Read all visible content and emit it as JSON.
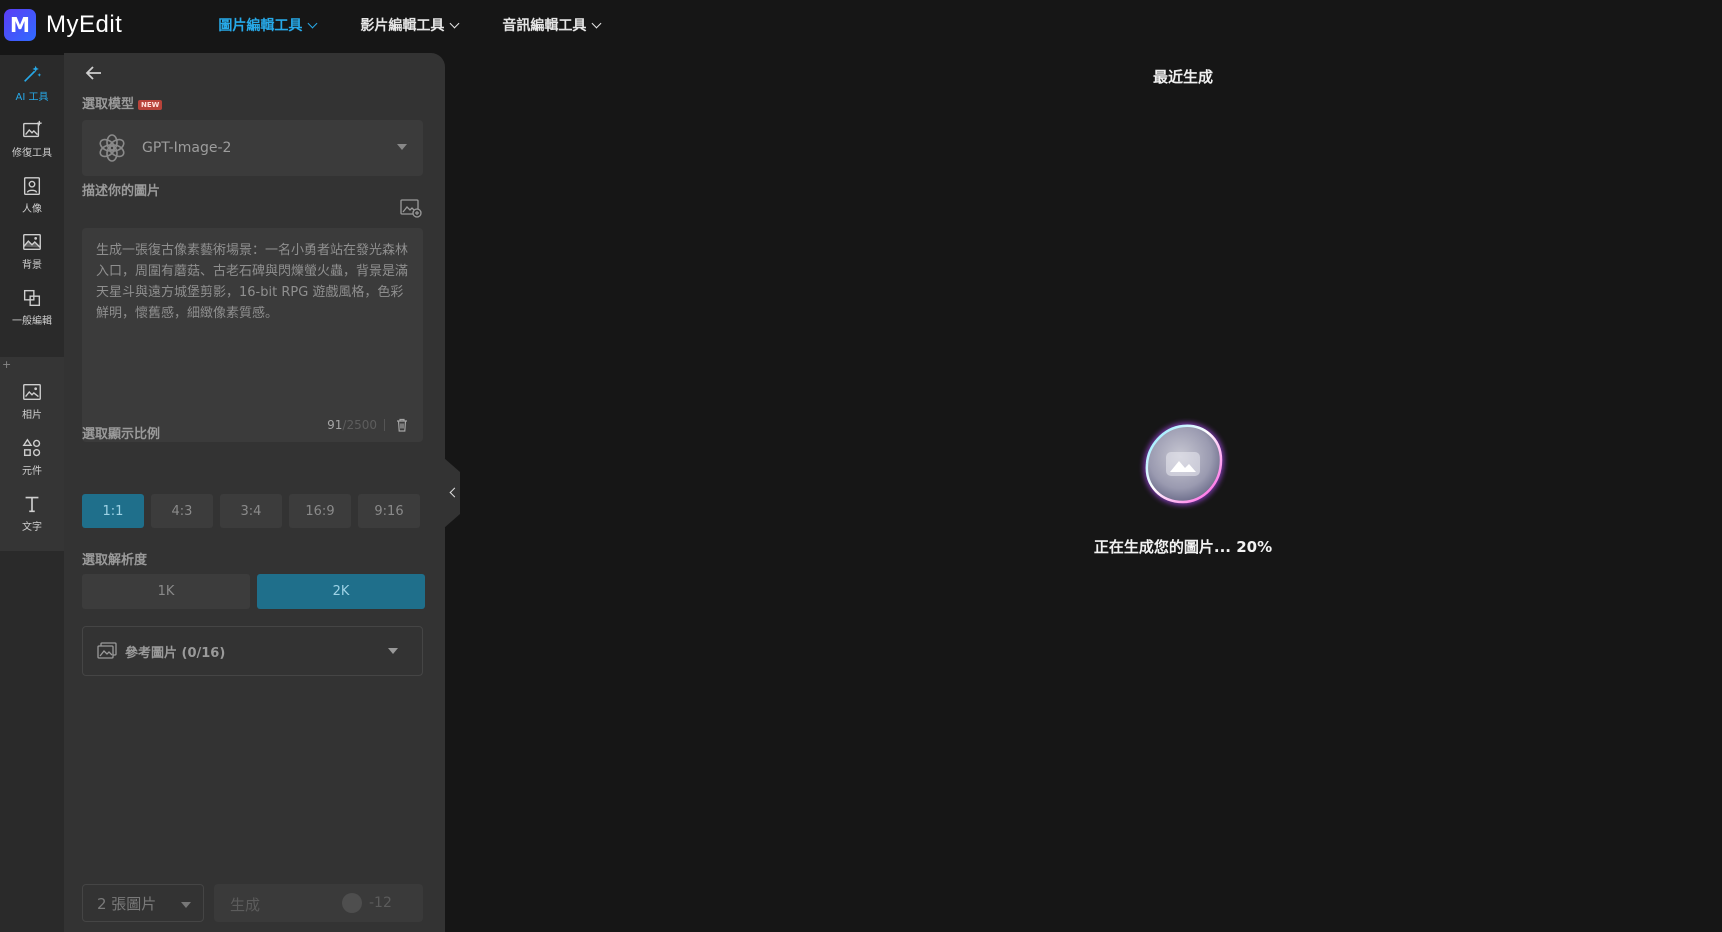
{
  "app": {
    "name": "MyEdit",
    "logo_letter": "M"
  },
  "nav": {
    "items": [
      {
        "label": "圖片編輯工具",
        "active": true
      },
      {
        "label": "影片編輯工具",
        "active": false
      },
      {
        "label": "音訊編輯工具",
        "active": false
      }
    ]
  },
  "rail": {
    "items": [
      {
        "label": "AI 工具",
        "icon": "magic-wand-icon",
        "active": true
      },
      {
        "label": "修復工具",
        "icon": "image-repair-icon"
      },
      {
        "label": "人像",
        "icon": "portrait-icon"
      },
      {
        "label": "背景",
        "icon": "background-icon"
      },
      {
        "label": "一般編輯",
        "icon": "crop-icon"
      },
      {
        "label": "相片",
        "icon": "photo-icon"
      },
      {
        "label": "元件",
        "icon": "shapes-icon"
      },
      {
        "label": "文字",
        "icon": "text-icon"
      }
    ],
    "plus": "+"
  },
  "panel": {
    "model_section": {
      "title": "選取模型",
      "badge": "NEW"
    },
    "model": {
      "name": "GPT-Image-2"
    },
    "prompt_section": {
      "title": "描述你的圖片"
    },
    "prompt": {
      "text": "生成一張復古像素藝術場景：一名小勇者站在發光森林入口，周圍有蘑菇、古老石碑與閃爍螢火蟲，背景是滿天星斗與遠方城堡剪影，16-bit RPG 遊戲風格，色彩鮮明，懷舊感，細緻像素質感。",
      "count": "91",
      "max": "/2500"
    },
    "ratio_section": {
      "title": "選取顯示比例"
    },
    "ratios": [
      {
        "label": "1:1",
        "active": true
      },
      {
        "label": "4:3",
        "active": false
      },
      {
        "label": "3:4",
        "active": false
      },
      {
        "label": "16:9",
        "active": false
      },
      {
        "label": "9:16",
        "active": false
      }
    ],
    "resolution_section": {
      "title": "選取解析度"
    },
    "resolutions": [
      {
        "label": "1K",
        "active": false
      },
      {
        "label": "2K",
        "active": true
      }
    ],
    "reference": {
      "label": "參考圖片 (0/16)"
    },
    "image_count": {
      "label": "2 張圖片"
    },
    "generate": {
      "label": "生成",
      "credits": "-12"
    }
  },
  "main": {
    "recent_title": "最近生成",
    "progress_text": "正在生成您的圖片... 20%",
    "progress_percent": 20
  },
  "colors": {
    "accent": "#27a9e8",
    "selected_button": "#1f6f8b",
    "background": "#161616",
    "panel": "#333333"
  }
}
